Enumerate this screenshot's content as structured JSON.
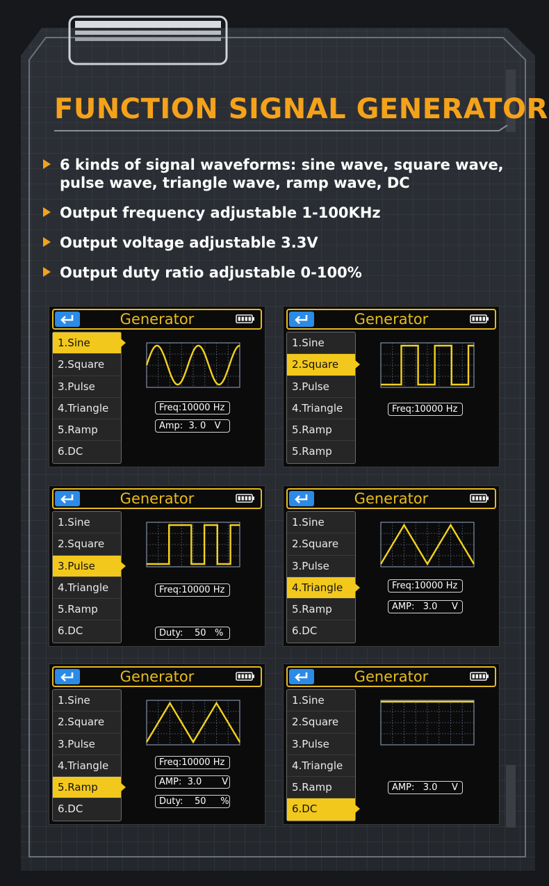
{
  "title": "FUNCTION SIGNAL GENERATOR",
  "features": [
    "6 kinds of signal waveforms: sine wave, square wave, pulse wave, triangle wave, ramp wave, DC",
    "Output frequency adjustable 1-100KHz",
    "Output voltage adjustable 3.3V",
    "Output duty ratio adjustable 0-100%"
  ],
  "colors": {
    "accent": "#f5a21b",
    "screen_yellow": "#f2c81c",
    "back_button": "#2b8be6"
  },
  "screens": [
    {
      "header": "Generator",
      "menu": [
        "1.Sine",
        "2.Square",
        "3.Pulse",
        "4.Triangle",
        "5.Ramp",
        "6.DC"
      ],
      "active_index": 0,
      "waveform": "sine",
      "fields": [
        {
          "text": "Freq:10000 Hz"
        },
        {
          "text": "Amp:  3. 0   V"
        }
      ]
    },
    {
      "header": "Generator",
      "menu": [
        "1.Sine",
        "2.Square",
        "3.Pulse",
        "4.Triangle",
        "5.Ramp",
        "5.Ramp"
      ],
      "active_index": 1,
      "waveform": "square",
      "fields": [
        {
          "text": "Freq:10000 Hz"
        }
      ]
    },
    {
      "header": "Generator",
      "menu": [
        "1.Sine",
        "2.Square",
        "3.Pulse",
        "4.Triangle",
        "5.Ramp",
        "6.DC"
      ],
      "active_index": 2,
      "waveform": "pulse",
      "fields": [
        {
          "text": "Freq:10000 Hz"
        },
        {
          "text": "Duty:    50   %"
        }
      ]
    },
    {
      "header": "Generator",
      "menu": [
        "1.Sine",
        "2.Square",
        "3.Pulse",
        "4.Triangle",
        "5.Ramp",
        "6.DC"
      ],
      "active_index": 3,
      "waveform": "triangle",
      "fields": [
        {
          "text": "Freq:10000 Hz"
        },
        {
          "text": "AMP:   3.0     V"
        }
      ]
    },
    {
      "header": "Generator",
      "menu": [
        "1.Sine",
        "2.Square",
        "3.Pulse",
        "4.Triangle",
        "5.Ramp",
        "6.DC"
      ],
      "active_index": 4,
      "waveform": "ramp",
      "fields": [
        {
          "text": "Freq:10000 Hz"
        },
        {
          "text": "AMP:  3.0       V"
        },
        {
          "text": "Duty:    50     %"
        }
      ]
    },
    {
      "header": "Generator",
      "menu": [
        "1.Sine",
        "2.Square",
        "3.Pulse",
        "4.Triangle",
        "5.Ramp",
        "6.DC"
      ],
      "active_index": 5,
      "waveform": "dc",
      "fields": [
        {
          "text": "AMP:   3.0     V"
        }
      ]
    }
  ]
}
